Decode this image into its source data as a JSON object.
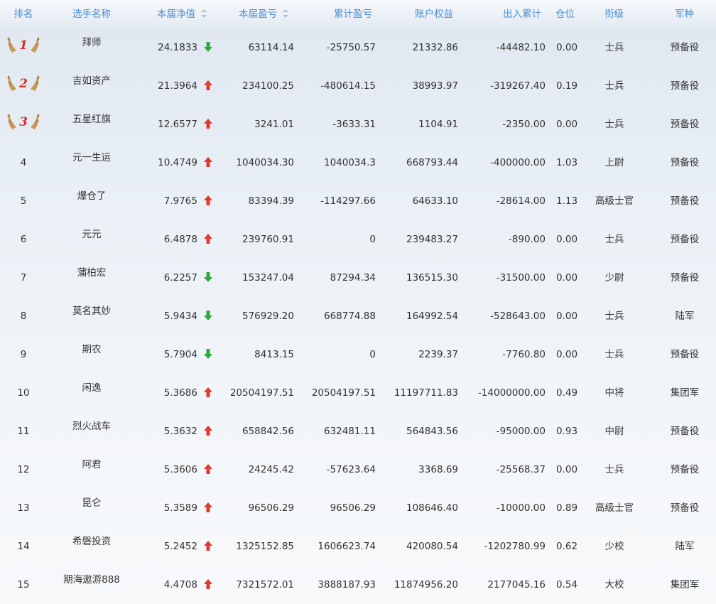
{
  "header": {
    "rank": "排名",
    "name": "选手名称",
    "net_value": "本届净值",
    "pnl": "本届盈亏",
    "cum_pnl": "累计盈亏",
    "equity": "账户权益",
    "in_out": "出入累计",
    "position": "仓位",
    "title": "衔级",
    "branch": "军种"
  },
  "icons": {
    "sortable": "sort-icon",
    "up": "arrow-up-icon",
    "down": "arrow-down-icon",
    "medal": "laurel-medal-icon"
  },
  "colors": {
    "header_text": "#4a8fd4",
    "up": "#e03a2f",
    "down": "#2fa83a",
    "medal_num": "#d9302a"
  },
  "rows": [
    {
      "rank": "1",
      "medal": "1",
      "name": "拜师",
      "nv": "24.1833",
      "dir": "down",
      "pnl": "63114.14",
      "cum": "-25750.57",
      "eq": "21332.86",
      "io": "-44482.10",
      "pos": "0.00",
      "title": "士兵",
      "branch": "预备役"
    },
    {
      "rank": "2",
      "medal": "2",
      "name": "吉如资产",
      "nv": "21.3964",
      "dir": "up",
      "pnl": "234100.25",
      "cum": "-480614.15",
      "eq": "38993.97",
      "io": "-319267.40",
      "pos": "0.19",
      "title": "士兵",
      "branch": "预备役"
    },
    {
      "rank": "3",
      "medal": "3",
      "name": "五星红旗",
      "nv": "12.6577",
      "dir": "up",
      "pnl": "3241.01",
      "cum": "-3633.31",
      "eq": "1104.91",
      "io": "-2350.00",
      "pos": "0.00",
      "title": "士兵",
      "branch": "预备役"
    },
    {
      "rank": "4",
      "name": "元一生运",
      "nv": "10.4749",
      "dir": "up",
      "pnl": "1040034.30",
      "cum": "1040034.3",
      "eq": "668793.44",
      "io": "-400000.00",
      "pos": "1.03",
      "title": "上尉",
      "branch": "预备役"
    },
    {
      "rank": "5",
      "name": "爆仓了",
      "nv": "7.9765",
      "dir": "up",
      "pnl": "83394.39",
      "cum": "-114297.66",
      "eq": "64633.10",
      "io": "-28614.00",
      "pos": "1.13",
      "title": "高级士官",
      "branch": "预备役"
    },
    {
      "rank": "6",
      "name": "元元",
      "nv": "6.4878",
      "dir": "up",
      "pnl": "239760.91",
      "cum": "0",
      "eq": "239483.27",
      "io": "-890.00",
      "pos": "0.00",
      "title": "士兵",
      "branch": "预备役"
    },
    {
      "rank": "7",
      "name": "蒲柏宏",
      "nv": "6.2257",
      "dir": "down",
      "pnl": "153247.04",
      "cum": "87294.34",
      "eq": "136515.30",
      "io": "-31500.00",
      "pos": "0.00",
      "title": "少尉",
      "branch": "预备役"
    },
    {
      "rank": "8",
      "name": "莫名其妙",
      "nv": "5.9434",
      "dir": "down",
      "pnl": "576929.20",
      "cum": "668774.88",
      "eq": "164992.54",
      "io": "-528643.00",
      "pos": "0.00",
      "title": "士兵",
      "branch": "陆军"
    },
    {
      "rank": "9",
      "name": "期农",
      "nv": "5.7904",
      "dir": "down",
      "pnl": "8413.15",
      "cum": "0",
      "eq": "2239.37",
      "io": "-7760.80",
      "pos": "0.00",
      "title": "士兵",
      "branch": "预备役"
    },
    {
      "rank": "10",
      "name": "闲逸",
      "nv": "5.3686",
      "dir": "up",
      "pnl": "20504197.51",
      "cum": "20504197.51",
      "eq": "11197711.83",
      "io": "-14000000.00",
      "pos": "0.49",
      "title": "中将",
      "branch": "集团军"
    },
    {
      "rank": "11",
      "name": "烈火战车",
      "nv": "5.3632",
      "dir": "up",
      "pnl": "658842.56",
      "cum": "632481.11",
      "eq": "564843.56",
      "io": "-95000.00",
      "pos": "0.93",
      "title": "中尉",
      "branch": "预备役"
    },
    {
      "rank": "12",
      "name": "阿君",
      "nv": "5.3606",
      "dir": "up",
      "pnl": "24245.42",
      "cum": "-57623.64",
      "eq": "3368.69",
      "io": "-25568.37",
      "pos": "0.00",
      "title": "士兵",
      "branch": "预备役"
    },
    {
      "rank": "13",
      "name": "昆仑",
      "nv": "5.3589",
      "dir": "up",
      "pnl": "96506.29",
      "cum": "96506.29",
      "eq": "108646.40",
      "io": "-10000.00",
      "pos": "0.89",
      "title": "高级士官",
      "branch": "预备役"
    },
    {
      "rank": "14",
      "name": "希磐投资",
      "nv": "5.2452",
      "dir": "up",
      "pnl": "1325152.85",
      "cum": "1606623.74",
      "eq": "420080.54",
      "io": "-1202780.99",
      "pos": "0.62",
      "title": "少校",
      "branch": "陆军"
    },
    {
      "rank": "15",
      "name": "期海遨游888",
      "nv": "4.4708",
      "dir": "up",
      "pnl": "7321572.01",
      "cum": "3888187.93",
      "eq": "11874956.20",
      "io": "2177045.16",
      "pos": "0.54",
      "title": "大校",
      "branch": "集团军"
    }
  ]
}
